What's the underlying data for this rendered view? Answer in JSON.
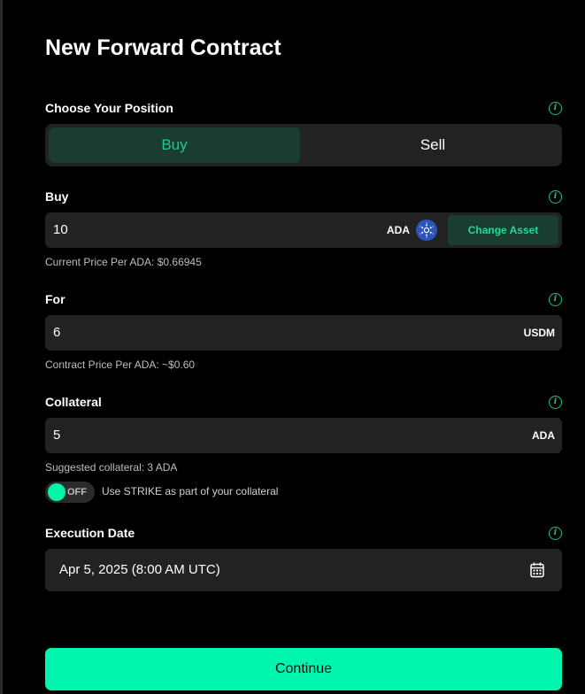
{
  "page_title": "New Forward Contract",
  "info_glyph": "i",
  "position": {
    "label": "Choose Your Position",
    "options": [
      "Buy",
      "Sell"
    ],
    "selected": "Buy"
  },
  "buy": {
    "label": "Buy",
    "value": "10",
    "unit": "ADA",
    "asset_icon": "cardano-icon",
    "change_asset_label": "Change Asset",
    "current_price": "Current Price Per ADA: $0.66945"
  },
  "for": {
    "label": "For",
    "value": "6",
    "unit": "USDM",
    "contract_price": "Contract Price Per ADA: ~$0.60"
  },
  "collateral": {
    "label": "Collateral",
    "value": "5",
    "unit": "ADA",
    "suggested": "Suggested collateral: 3 ADA",
    "strike_toggle_state": "OFF",
    "strike_toggle_label": "Use STRIKE as part of your collateral"
  },
  "execution_date": {
    "label": "Execution Date",
    "value": "Apr 5, 2025 (8:00 AM UTC)",
    "icon": "calendar-icon"
  },
  "continue_label": "Continue",
  "colors": {
    "accent": "#00f5ad",
    "accent_dark": "#1b3d30",
    "field_bg": "#222222",
    "page_bg": "#000000"
  }
}
